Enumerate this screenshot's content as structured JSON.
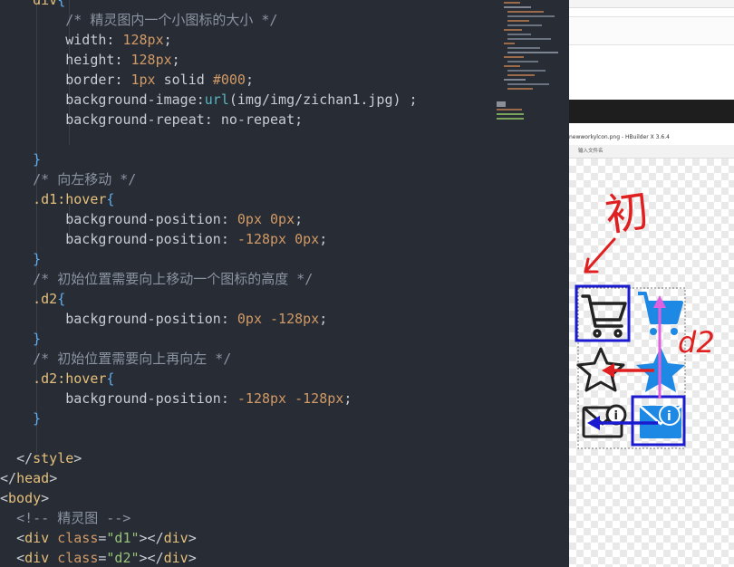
{
  "editor": {
    "lines": [
      [
        {
          "t": "    "
        },
        {
          "t": "div",
          "c": "c-tag"
        },
        {
          "t": "{",
          "c": "c-brace"
        }
      ],
      [
        {
          "t": "        "
        },
        {
          "t": "/* 精灵图内一个小图标的大小 */",
          "c": "c-cmt"
        }
      ],
      [
        {
          "t": "        "
        },
        {
          "t": "width",
          "c": "c-prop"
        },
        {
          "t": ": "
        },
        {
          "t": "128px",
          "c": "c-val"
        },
        {
          "t": ";"
        }
      ],
      [
        {
          "t": "        "
        },
        {
          "t": "height",
          "c": "c-prop"
        },
        {
          "t": ": "
        },
        {
          "t": "128px",
          "c": "c-val"
        },
        {
          "t": ";"
        }
      ],
      [
        {
          "t": "        "
        },
        {
          "t": "border",
          "c": "c-prop"
        },
        {
          "t": ": "
        },
        {
          "t": "1px",
          "c": "c-val"
        },
        {
          "t": " solid "
        },
        {
          "t": "#000",
          "c": "c-val"
        },
        {
          "t": ";"
        }
      ],
      [
        {
          "t": "        "
        },
        {
          "t": "background-image",
          "c": "c-prop"
        },
        {
          "t": ":"
        },
        {
          "t": "url",
          "c": "c-fn"
        },
        {
          "t": "(img/img/zichan1.jpg) ;"
        }
      ],
      [
        {
          "t": "        "
        },
        {
          "t": "background-repeat",
          "c": "c-prop"
        },
        {
          "t": ": no-repeat;"
        }
      ],
      [
        {
          "t": ""
        }
      ],
      [
        {
          "t": "    "
        },
        {
          "t": "}",
          "c": "c-brace"
        }
      ],
      [
        {
          "t": "    "
        },
        {
          "t": "/* 向左移动 */",
          "c": "c-cmt"
        }
      ],
      [
        {
          "t": "    "
        },
        {
          "t": ".d1:hover",
          "c": "c-sel"
        },
        {
          "t": "{",
          "c": "c-brace"
        }
      ],
      [
        {
          "t": "        "
        },
        {
          "t": "background-position",
          "c": "c-prop"
        },
        {
          "t": ": "
        },
        {
          "t": "0px 0px",
          "c": "c-val"
        },
        {
          "t": ";"
        }
      ],
      [
        {
          "t": "        "
        },
        {
          "t": "background-position",
          "c": "c-prop"
        },
        {
          "t": ": "
        },
        {
          "t": "-128px 0px",
          "c": "c-val"
        },
        {
          "t": ";"
        }
      ],
      [
        {
          "t": "    "
        },
        {
          "t": "}",
          "c": "c-brace"
        }
      ],
      [
        {
          "t": "    "
        },
        {
          "t": "/* 初始位置需要向上移动一个图标的高度 */",
          "c": "c-cmt"
        }
      ],
      [
        {
          "t": "    "
        },
        {
          "t": ".d2",
          "c": "c-sel"
        },
        {
          "t": "{",
          "c": "c-brace"
        }
      ],
      [
        {
          "t": "        "
        },
        {
          "t": "background-position",
          "c": "c-prop"
        },
        {
          "t": ": "
        },
        {
          "t": "0px -128px",
          "c": "c-val"
        },
        {
          "t": ";"
        }
      ],
      [
        {
          "t": "    "
        },
        {
          "t": "}",
          "c": "c-brace"
        }
      ],
      [
        {
          "t": "    "
        },
        {
          "t": "/* 初始位置需要向上再向左 */",
          "c": "c-cmt"
        }
      ],
      [
        {
          "t": "    "
        },
        {
          "t": ".d2:hover",
          "c": "c-sel"
        },
        {
          "t": "{",
          "c": "c-brace"
        }
      ],
      [
        {
          "t": "        "
        },
        {
          "t": "background-position",
          "c": "c-prop"
        },
        {
          "t": ": "
        },
        {
          "t": "-128px -128px",
          "c": "c-val"
        },
        {
          "t": ";"
        }
      ],
      [
        {
          "t": "    "
        },
        {
          "t": "}",
          "c": "c-brace"
        }
      ],
      [
        {
          "t": ""
        }
      ],
      [
        {
          "t": "  "
        },
        {
          "t": "</",
          "c": "c-ang"
        },
        {
          "t": "style",
          "c": "c-tag"
        },
        {
          "t": ">",
          "c": "c-ang"
        }
      ],
      [
        {
          "t": "</",
          "c": "c-ang"
        },
        {
          "t": "head",
          "c": "c-tag"
        },
        {
          "t": ">",
          "c": "c-ang"
        }
      ],
      [
        {
          "t": "<",
          "c": "c-ang"
        },
        {
          "t": "body",
          "c": "c-tag"
        },
        {
          "t": ">",
          "c": "c-ang"
        }
      ],
      [
        {
          "t": "  "
        },
        {
          "t": "<!-- 精灵图 -->",
          "c": "c-cmt"
        }
      ],
      [
        {
          "t": "  "
        },
        {
          "t": "<",
          "c": "c-ang"
        },
        {
          "t": "div",
          "c": "c-tag"
        },
        {
          "t": " class",
          "c": "c-val"
        },
        {
          "t": "="
        },
        {
          "t": "\"d1\"",
          "c": "c-str"
        },
        {
          "t": "></",
          "c": "c-ang"
        },
        {
          "t": "div",
          "c": "c-tag"
        },
        {
          "t": ">",
          "c": "c-ang"
        }
      ],
      [
        {
          "t": "  "
        },
        {
          "t": "<",
          "c": "c-ang"
        },
        {
          "t": "div",
          "c": "c-tag"
        },
        {
          "t": " class",
          "c": "c-val"
        },
        {
          "t": "="
        },
        {
          "t": "\"d2\"",
          "c": "c-str"
        },
        {
          "t": "></",
          "c": "c-ang"
        },
        {
          "t": "div",
          "c": "c-tag"
        },
        {
          "t": ">",
          "c": "c-ang"
        }
      ]
    ]
  },
  "preview": {
    "window_title": "newworkylcon.png - HBuilder X 3.6.4",
    "search_placeholder": "输入文件名",
    "annotation_top": "初",
    "annotation_right": "d2"
  },
  "colors": {
    "editor_bg": "#282c34",
    "annotation_red": "#e02020",
    "box_blue": "#1a1ad0",
    "arrow_pink": "#e060e0",
    "icon_blue": "#1e88e5"
  },
  "icons": [
    "cart-icon",
    "cart-blue-icon",
    "star-outline-icon",
    "star-blue-icon",
    "mail-info-icon",
    "mail-info-blue-icon"
  ]
}
